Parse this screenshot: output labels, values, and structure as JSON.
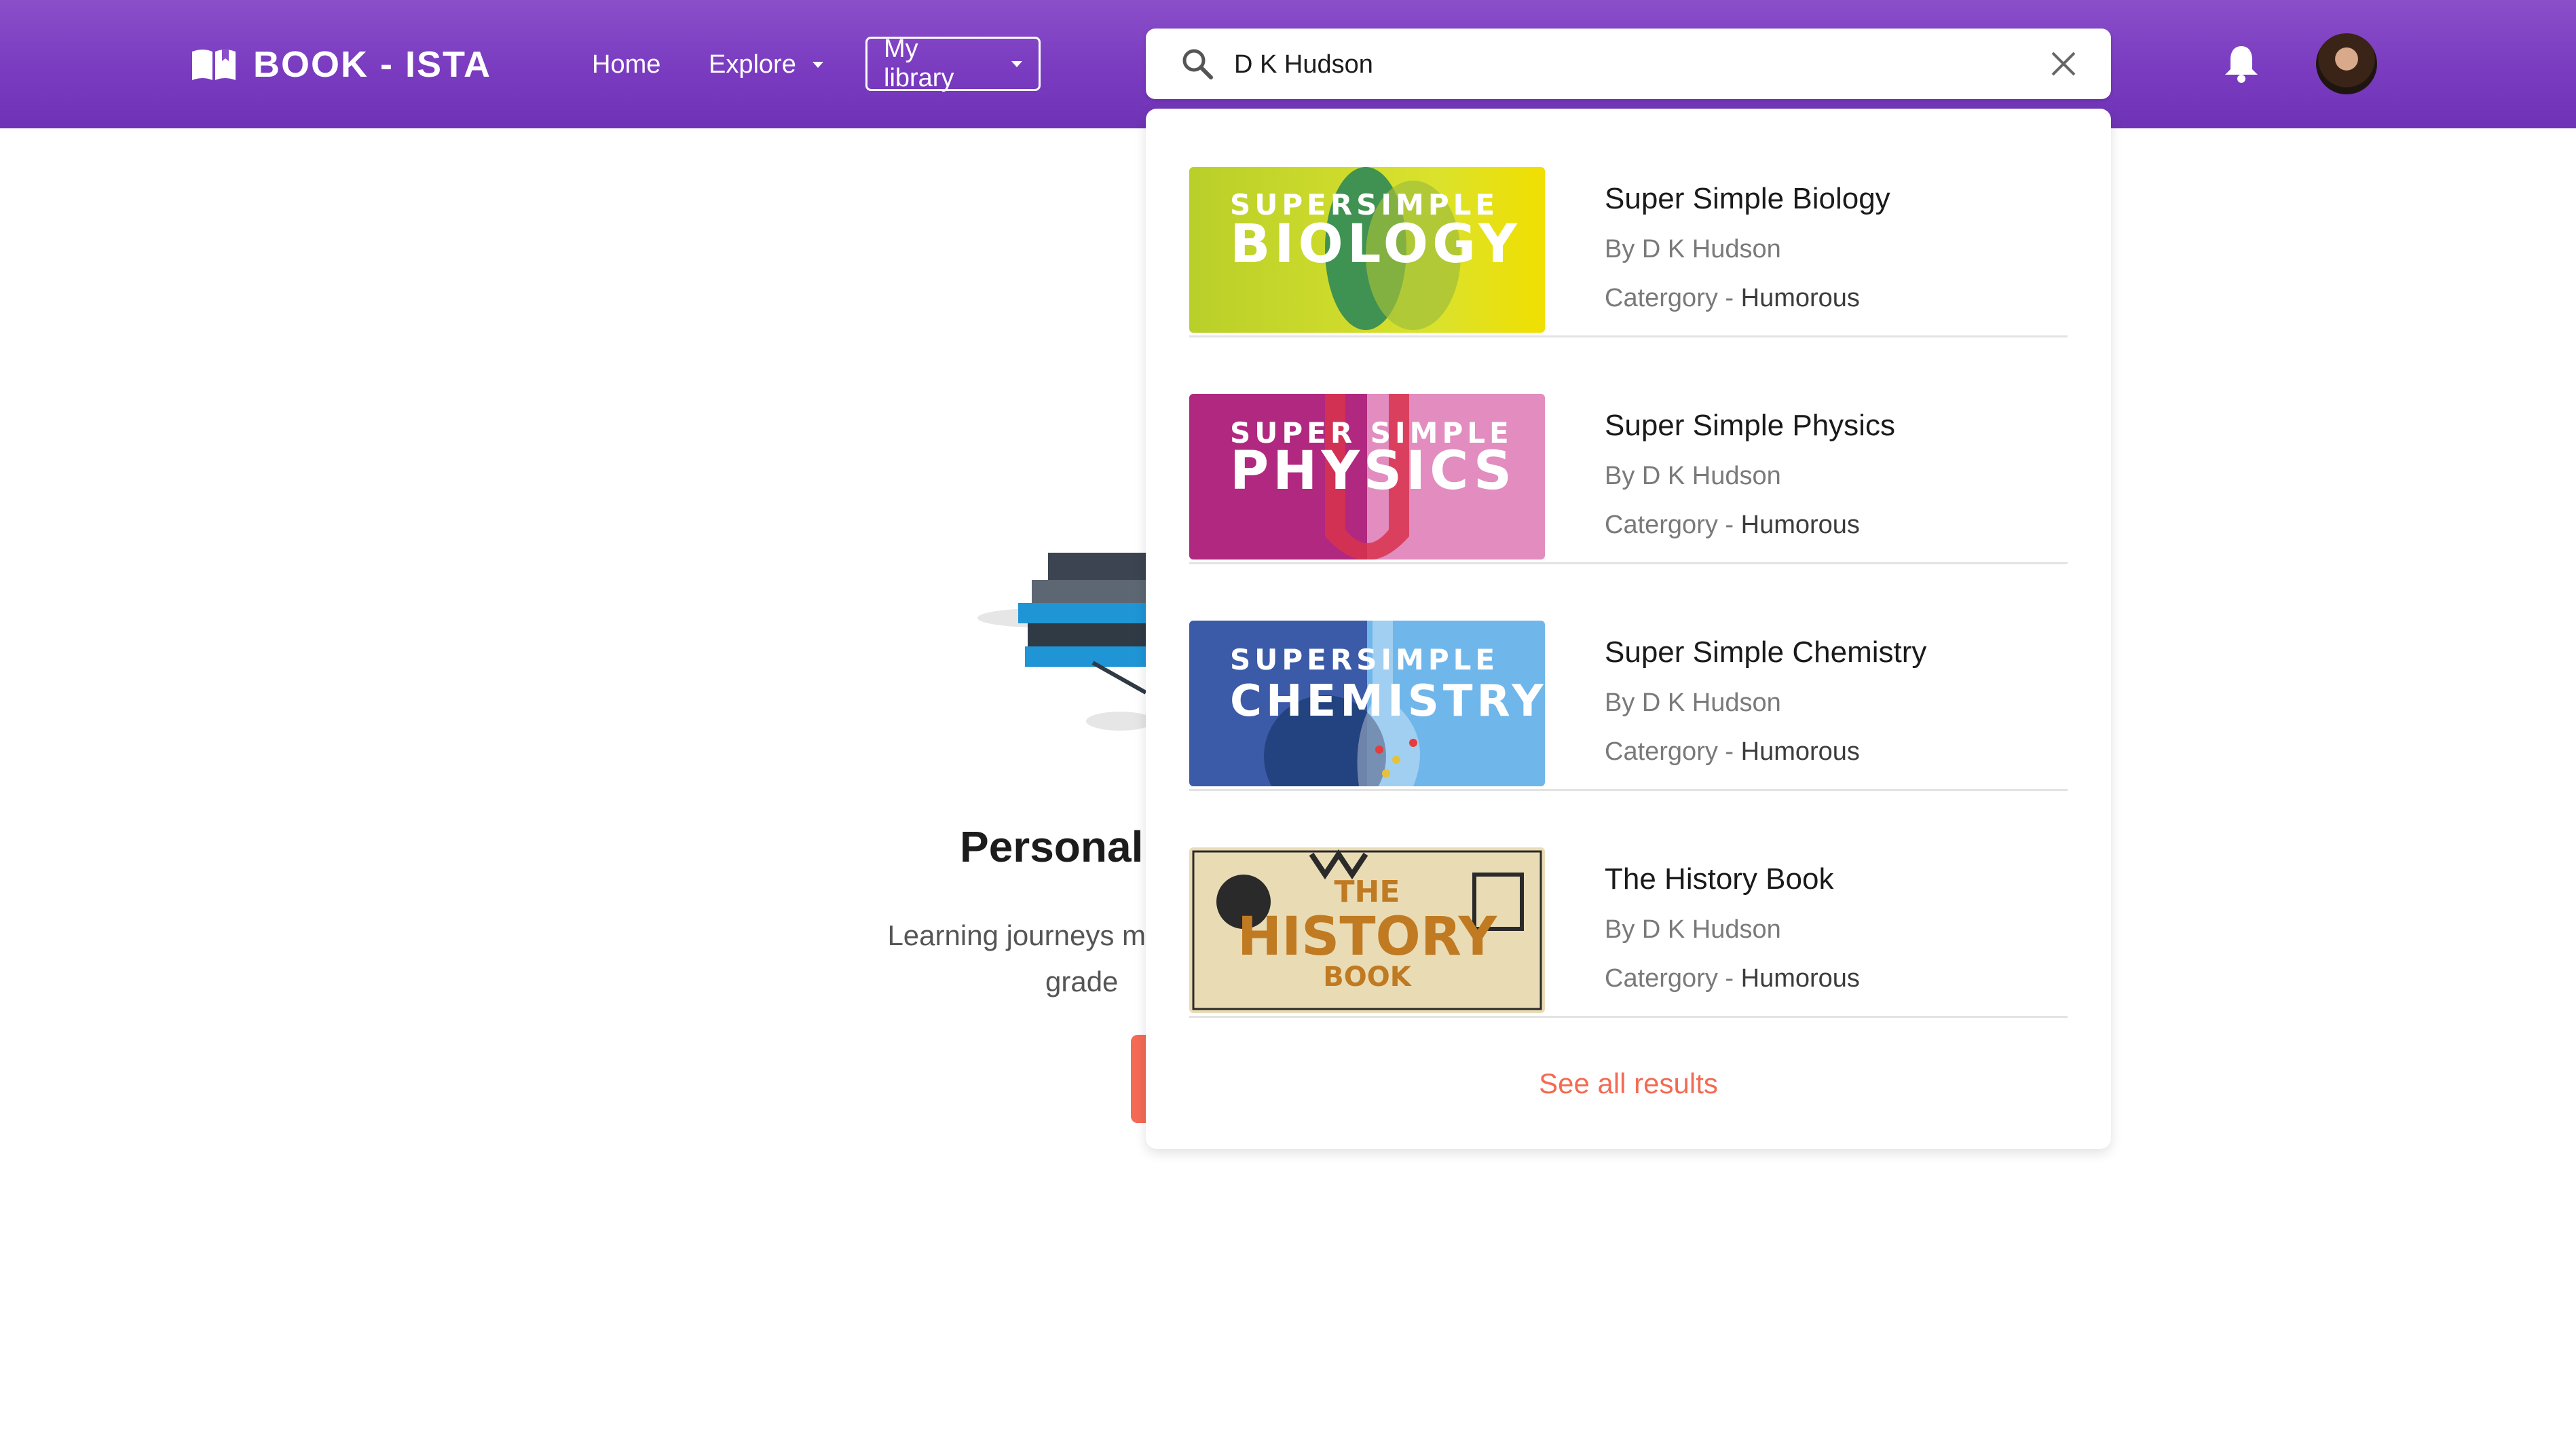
{
  "header": {
    "brand": "BOOK - ISTA",
    "nav": {
      "home": "Home",
      "explore": "Explore",
      "library": "My library"
    },
    "search_value": "D K Hudson"
  },
  "page": {
    "hero_title": "Personali",
    "hero_sub_line1": "Learning journeys m",
    "hero_sub_line2": "grade"
  },
  "results": [
    {
      "title": "Super Simple Biology",
      "author": "By D K Hudson",
      "category_label": "Catergory - ",
      "category_value": "Humorous",
      "cover_top": "SUPERSIMPLE",
      "cover_main": "BIOLOGY"
    },
    {
      "title": "Super Simple Physics",
      "author": "By D K Hudson",
      "category_label": "Catergory - ",
      "category_value": "Humorous",
      "cover_top": "SUPER SIMPLE",
      "cover_main": "PHYSICS"
    },
    {
      "title": "Super Simple Chemistry",
      "author": "By D K Hudson",
      "category_label": "Catergory - ",
      "category_value": "Humorous",
      "cover_top": "SUPERSIMPLE",
      "cover_main": "CHEMISTRY"
    },
    {
      "title": "The History Book",
      "author": "By D K Hudson",
      "category_label": "Catergory - ",
      "category_value": "Humorous",
      "cover_top": "THE",
      "cover_main": "HISTORY",
      "cover_bottom": "BOOK"
    }
  ],
  "see_all": "See all results",
  "colors": {
    "header": "#7a3bc0",
    "accent": "#f26b52",
    "biology": "#c5d42a",
    "physics": "#b5288a",
    "chemistry": "#3d63b5",
    "history": "#e9dcb5"
  }
}
